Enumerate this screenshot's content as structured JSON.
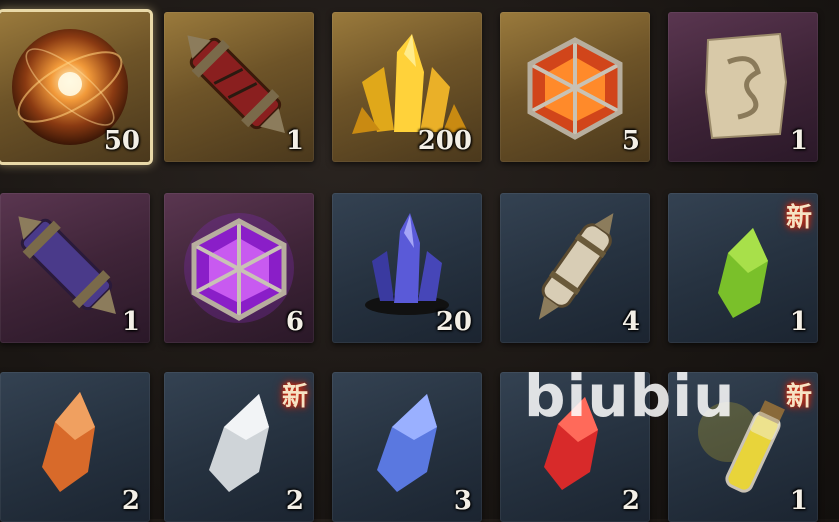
{
  "inventory": {
    "items": [
      {
        "name": "flame-orb-icon",
        "count": "50",
        "bg": "gold",
        "new": false,
        "selected": true
      },
      {
        "name": "red-scroll-case-icon",
        "count": "1",
        "bg": "gold",
        "new": false,
        "selected": false
      },
      {
        "name": "gold-crystal-cluster-icon",
        "count": "200",
        "bg": "gold",
        "new": false,
        "selected": false
      },
      {
        "name": "fire-cage-gem-icon",
        "count": "5",
        "bg": "gold",
        "new": false,
        "selected": false
      },
      {
        "name": "dragon-map-scroll-icon",
        "count": "1",
        "bg": "purple",
        "new": false,
        "selected": false
      },
      {
        "name": "purple-scroll-case-icon",
        "count": "1",
        "bg": "purple",
        "new": false,
        "selected": false
      },
      {
        "name": "purple-cage-gem-icon",
        "count": "6",
        "bg": "purple",
        "new": false,
        "selected": false
      },
      {
        "name": "blue-crystal-cluster-icon",
        "count": "20",
        "bg": "blue",
        "new": false,
        "selected": false
      },
      {
        "name": "bone-scroll-case-icon",
        "count": "4",
        "bg": "blue",
        "new": false,
        "selected": false
      },
      {
        "name": "green-shard-icon",
        "count": "1",
        "bg": "blue",
        "new": true,
        "selected": false
      },
      {
        "name": "orange-shard-icon",
        "count": "2",
        "bg": "blue",
        "new": false,
        "selected": false
      },
      {
        "name": "white-shard-icon",
        "count": "2",
        "bg": "blue",
        "new": true,
        "selected": false
      },
      {
        "name": "blue-shard-icon",
        "count": "3",
        "bg": "blue",
        "new": false,
        "selected": false
      },
      {
        "name": "red-shard-icon",
        "count": "2",
        "bg": "blue",
        "new": false,
        "selected": false
      },
      {
        "name": "yellow-potion-icon",
        "count": "1",
        "bg": "blue",
        "new": true,
        "selected": false
      }
    ],
    "new_label": "新"
  },
  "watermark": "biubiu",
  "colors": {
    "gold_bg": "#6e5428",
    "purple_bg": "#3f2438",
    "blue_bg": "#263240",
    "count_text": "#f3efe6",
    "new_glow": "#d4331a",
    "selected_border": "#e9d9a8"
  }
}
